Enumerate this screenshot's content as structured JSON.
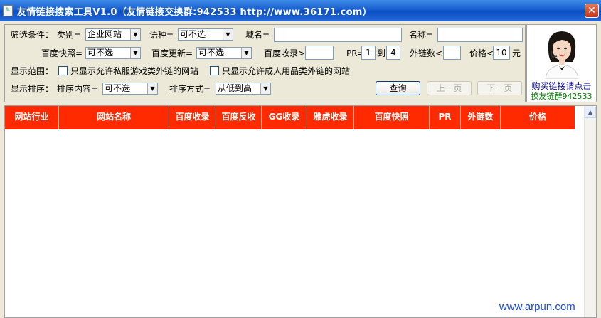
{
  "window": {
    "title": "友情链接搜索工具V1.0（友情链接交换群:942533 http://www.36171.com）",
    "close_glyph": "✕"
  },
  "filters": {
    "conditions_label": "筛选条件：",
    "category_label": "类别=",
    "category_value": "企业网站",
    "language_label": "语种=",
    "language_value": "可不选",
    "domain_label": "域名=",
    "domain_value": "",
    "name_label": "名称=",
    "name_value": "",
    "snapshot_label": "百度快照=",
    "snapshot_value": "可不选",
    "update_label": "百度更新=",
    "update_value": "可不选",
    "indexed_label": "百度收录>",
    "indexed_value": "",
    "pr_label": "PR=",
    "pr_min": "1",
    "pr_to": "到",
    "pr_max": "4",
    "outlinks_label": "外链数<",
    "outlinks_value": "",
    "price_label": "价格<",
    "price_value": "10",
    "price_unit": "元",
    "scope_label": "显示范围：",
    "scope_opt1": "只显示允许私服游戏类外链的网站",
    "scope_opt2": "只显示允许成人用品类外链的网站",
    "sort_label": "显示排序：",
    "sort_content_label": "排序内容=",
    "sort_content_value": "可不选",
    "sort_method_label": "排序方式=",
    "sort_method_value": "从低到高",
    "query_button": "查询",
    "prev_button": "上一页",
    "next_button": "下一页"
  },
  "promo": {
    "line1": "购买链接请点击",
    "line2": "换友链群942533"
  },
  "table": {
    "columns": [
      "网站行业",
      "网站名称",
      "百度收录",
      "百度反收",
      "GG收录",
      "雅虎收录",
      "百度快照",
      "PR",
      "外链数",
      "价格"
    ],
    "rows": []
  },
  "watermark": "www.arpun.com",
  "colors": {
    "titlebar": "#0a4fc4",
    "table_header": "#ff2a00",
    "promo_line2": "#008000"
  }
}
